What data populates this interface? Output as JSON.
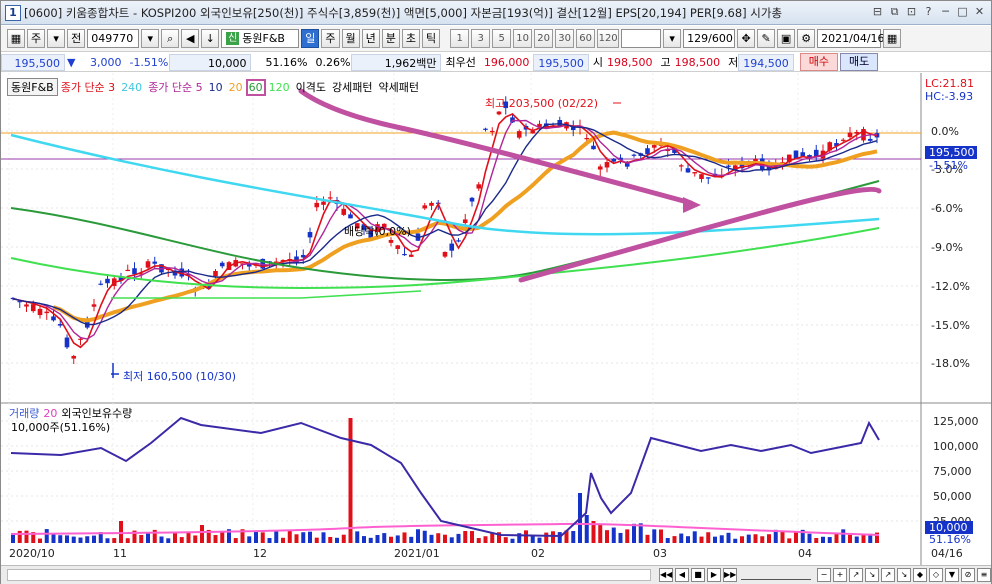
{
  "window": {
    "number": "1",
    "title": "[0600] 키움종합차트 - KOSPI200 외국인보유[250(천)] 주식수[3,859(천)] 액면[5,000] 자본금[193(억)] 결산[12월] EPS[20,194] PER[9.68] 시가총",
    "buttons": [
      "⊟",
      "⧉",
      "⊡",
      "?",
      "─",
      "□",
      "✕"
    ]
  },
  "toolbar": {
    "type_label": "주",
    "prev_label": "전",
    "code": "049770",
    "stock_name": "동원F&B",
    "stock_badge": "신",
    "periods": [
      "일",
      "주",
      "월",
      "년",
      "분",
      "초",
      "틱"
    ],
    "active_period": "일",
    "intervals": [
      "1",
      "3",
      "5",
      "10",
      "20",
      "30",
      "60",
      "120"
    ],
    "count": "129/600",
    "date": "2021/04/16"
  },
  "quote": {
    "price": "195,500",
    "change": "3,000",
    "change_pct": "-1.51%",
    "volume": "10,000",
    "ratio": "51.16%",
    "turnover_pct": "0.26%",
    "amount": "1,962백만",
    "best_label": "최우선",
    "best_ask": "196,000",
    "best_bid": "195,500",
    "open_label": "시",
    "open": "198,500",
    "high_label": "고",
    "high": "198,500",
    "low_label": "저",
    "low": "194,500",
    "buy": "매수",
    "sell": "매도"
  },
  "legend_price": {
    "name": "동원F&B",
    "ma1": "종가 단순 3",
    "ma1b": "240",
    "ma2": "종가 단순 5",
    "ma_10": "10",
    "ma_20": "20",
    "ma_60": "60",
    "ma_120": "120",
    "disparity": "이격도",
    "strong": "강세패턴",
    "weak": "약세패턴"
  },
  "legend_volume": {
    "vol": "거래량",
    "vol_n": "20",
    "foreign": "외국인보유수량",
    "unit": "10,000주(51.16%)"
  },
  "annotations": {
    "high": "최고 203,500 (02/22)",
    "low": "최저 160,500 (10/30)",
    "dividend": "배당락(0,0%)",
    "lc": "LC:21.81",
    "hc": "HC:-3.93",
    "price_tag": "195,500",
    "pct_tag": "-1.51%",
    "vol_tag": "10,000",
    "ratio_tag": "51.16%"
  },
  "y_axis_price": [
    "0.0%",
    "-3.0%",
    "-6.0%",
    "-9.0%",
    "-12.0%",
    "-15.0%",
    "-18.0%"
  ],
  "y_axis_volume": [
    "125,000",
    "100,000",
    "75,000",
    "50,000",
    "25,000"
  ],
  "x_axis": [
    "2020/10",
    "11",
    "12",
    "2021/01",
    "02",
    "03",
    "04",
    "04/16"
  ],
  "colors": {
    "up": "#e0101a",
    "down": "#1533c8",
    "ma3": "#e0101a",
    "ma5": "#b0259a",
    "ma10": "#1a2a8a",
    "ma20": "#f0a020",
    "ma60": "#2a9a3a",
    "ma120": "#40e050",
    "ma240": "#40d8f0",
    "foreign_line": "#3a2aa8",
    "highlight": "#c050a0"
  }
}
